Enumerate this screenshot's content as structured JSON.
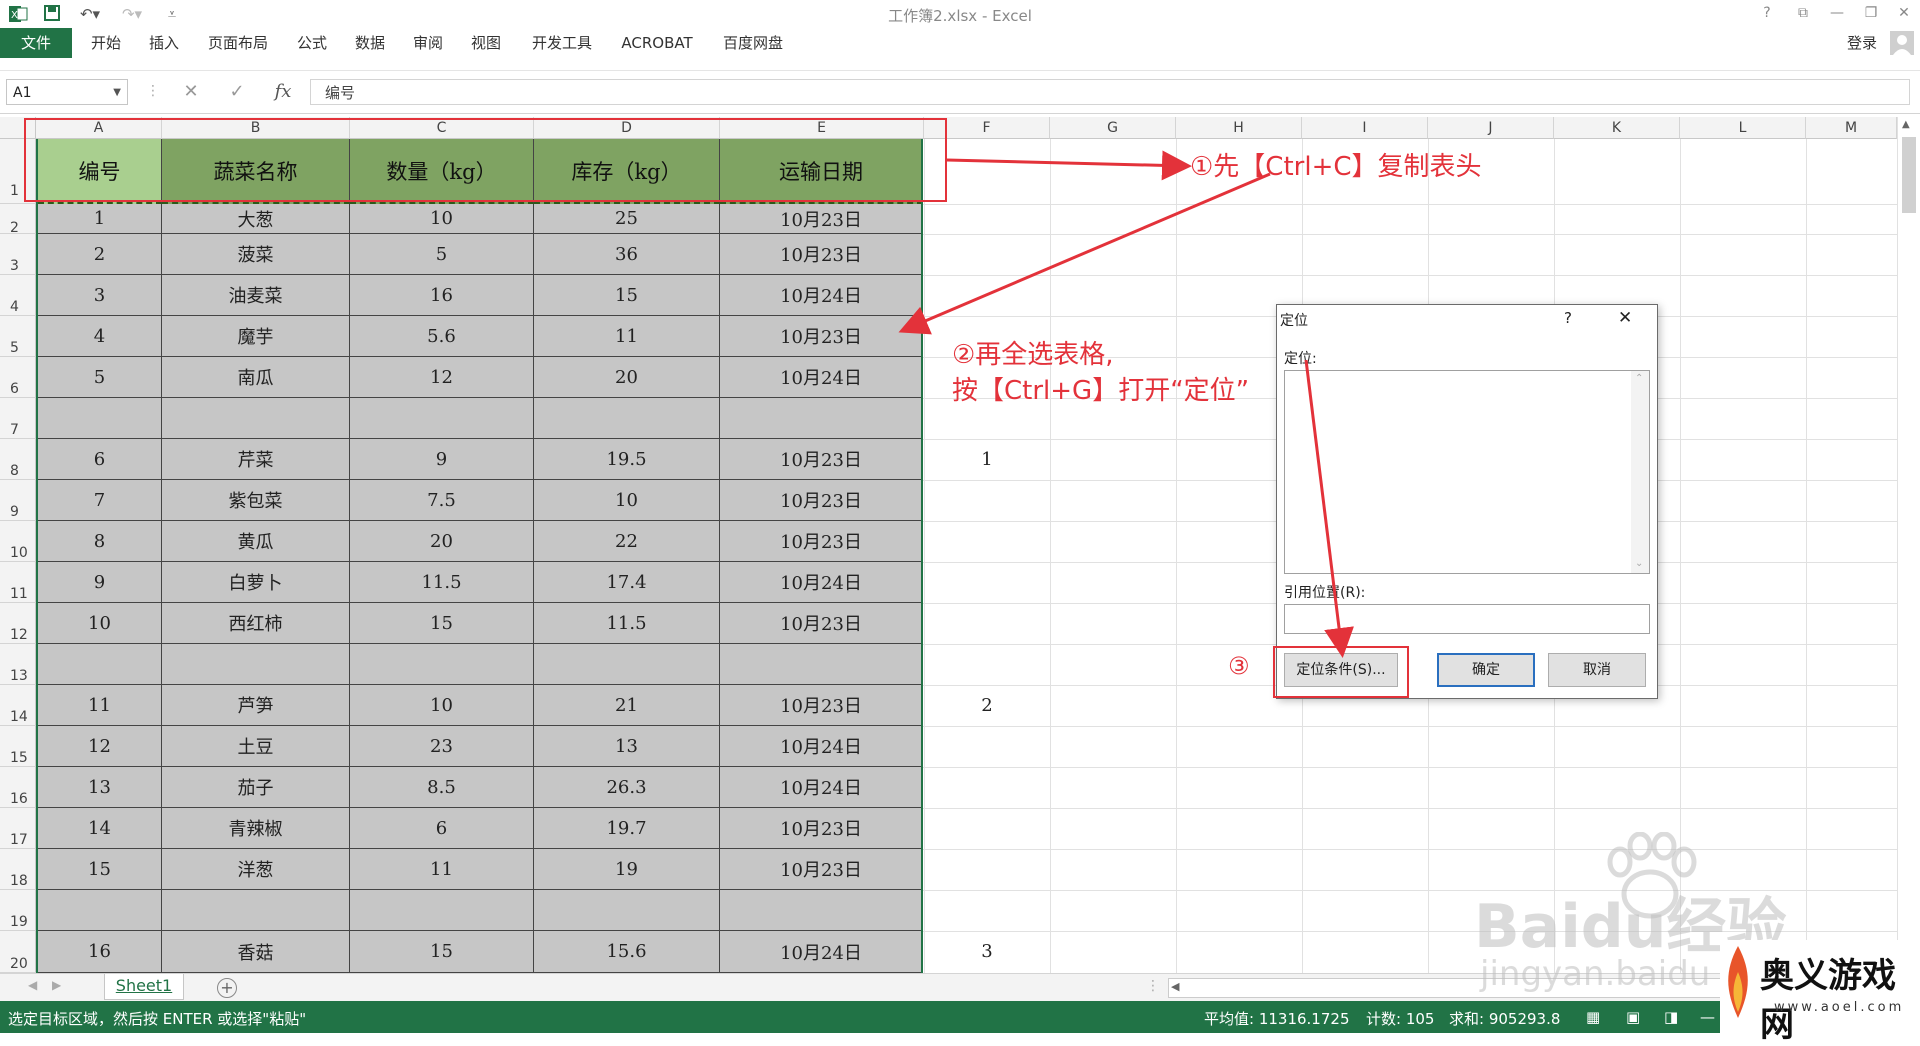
{
  "window": {
    "title": "工作簿2.xlsx - Excel",
    "help": "?",
    "login": "登录"
  },
  "ribbon": {
    "tabs": [
      "文件",
      "开始",
      "插入",
      "页面布局",
      "公式",
      "数据",
      "审阅",
      "视图",
      "开发工具",
      "ACROBAT",
      "百度网盘"
    ]
  },
  "formula_bar": {
    "name_box": "A1",
    "cancel_icon": "✕",
    "enter_icon": "✓",
    "fx": "fx",
    "content": "编号"
  },
  "columns": [
    "A",
    "B",
    "C",
    "D",
    "E",
    "F",
    "G",
    "H",
    "I",
    "J",
    "K",
    "L",
    "M"
  ],
  "rows": [
    "1",
    "2",
    "3",
    "4",
    "5",
    "6",
    "7",
    "8",
    "9",
    "10",
    "11",
    "12",
    "13",
    "14",
    "15",
    "16",
    "17",
    "18",
    "19",
    "20"
  ],
  "table": {
    "headers": [
      "编号",
      "蔬菜名称",
      "数量（kg）",
      "库存（kg）",
      "运输日期"
    ],
    "rows": [
      [
        "1",
        "大葱",
        "10",
        "25",
        "10月23日"
      ],
      [
        "2",
        "菠菜",
        "5",
        "36",
        "10月23日"
      ],
      [
        "3",
        "油麦菜",
        "16",
        "15",
        "10月24日"
      ],
      [
        "4",
        "魔芋",
        "5.6",
        "11",
        "10月23日"
      ],
      [
        "5",
        "南瓜",
        "12",
        "20",
        "10月24日"
      ],
      [
        "",
        "",
        "",
        "",
        ""
      ],
      [
        "6",
        "芹菜",
        "9",
        "19.5",
        "10月23日"
      ],
      [
        "7",
        "紫包菜",
        "7.5",
        "10",
        "10月23日"
      ],
      [
        "8",
        "黄瓜",
        "20",
        "22",
        "10月23日"
      ],
      [
        "9",
        "白萝卜",
        "11.5",
        "17.4",
        "10月24日"
      ],
      [
        "10",
        "西红柿",
        "15",
        "11.5",
        "10月23日"
      ],
      [
        "",
        "",
        "",
        "",
        ""
      ],
      [
        "11",
        "芦笋",
        "10",
        "21",
        "10月23日"
      ],
      [
        "12",
        "土豆",
        "23",
        "13",
        "10月24日"
      ],
      [
        "13",
        "茄子",
        "8.5",
        "26.3",
        "10月24日"
      ],
      [
        "14",
        "青辣椒",
        "6",
        "19.7",
        "10月23日"
      ],
      [
        "15",
        "洋葱",
        "11",
        "19",
        "10月23日"
      ],
      [
        "",
        "",
        "",
        "",
        ""
      ],
      [
        "16",
        "香菇",
        "15",
        "15.6",
        "10月24日"
      ]
    ]
  },
  "column_f": {
    "row8": "1",
    "row14": "2",
    "row20": "3"
  },
  "dialog": {
    "title": "定位",
    "help": "?",
    "close": "✕",
    "goto_label": "定位:",
    "ref_label": "引用位置(R):",
    "ref_value": "",
    "special_button": "定位条件(S)...",
    "ok_button": "确定",
    "cancel_button": "取消"
  },
  "sheets": {
    "active": "Sheet1",
    "add": "+"
  },
  "status": {
    "message": "选定目标区域，然后按 ENTER 或选择\"粘贴\"",
    "average": "平均值: 11316.1725",
    "count": "计数: 105",
    "sum": "求和: 905293.8"
  },
  "annotations": {
    "step1": "①先【Ctrl+C】复制表头",
    "step2_line1": "②再全选表格,",
    "step2_line2": "按【Ctrl+G】打开“定位”",
    "step3": "③"
  },
  "watermark": {
    "baidu": "Baidu经验",
    "url": "jingyan.baidu",
    "site_logo": "奥义游戏网",
    "site_url": "www.aoel.com"
  },
  "colors": {
    "excel_green": "#217346",
    "header_fill": "#7fa362",
    "selected_header_fill": "#a9cf8f",
    "selection_fill": "#c6c6c6",
    "annotation_red": "#e3323a"
  }
}
